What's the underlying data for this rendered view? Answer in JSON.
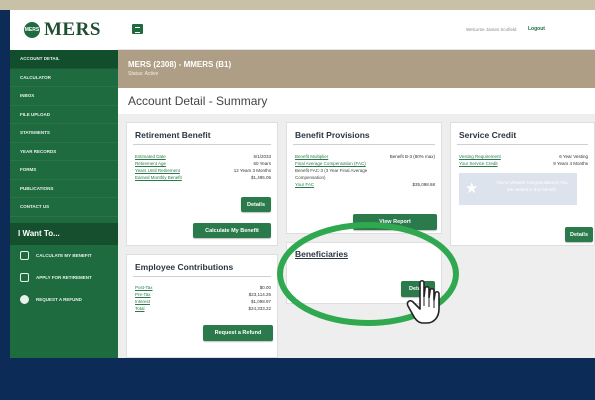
{
  "logo": {
    "mark": "MERS",
    "text": "MERS"
  },
  "sidebar": {
    "items": [
      {
        "label": "ACCOUNT DETAIL"
      },
      {
        "label": "CALCULATOR"
      },
      {
        "label": "INBOX"
      },
      {
        "label": "FILE UPLOAD"
      },
      {
        "label": "STATEMENTS"
      },
      {
        "label": "YEAR RECORDS"
      },
      {
        "label": "FORMS"
      },
      {
        "label": "PUBLICATIONS"
      },
      {
        "label": "CONTACT US"
      }
    ],
    "i_want_to": "I Want To...",
    "actions": [
      {
        "label": "CALCULATE MY BENEFIT",
        "icon": "calculator-icon"
      },
      {
        "label": "APPLY FOR RETIREMENT",
        "icon": "document-icon"
      },
      {
        "label": "REQUEST A REFUND",
        "icon": "hand-icon"
      }
    ]
  },
  "header": {
    "welcome": "Welcome James Scofield",
    "logout": "Logout"
  },
  "banner": {
    "title": "MERS (2308) - MMERS (B1)",
    "status": "Status: Active"
  },
  "page_title": "Account Detail - Summary",
  "retirement_benefit": {
    "title": "Retirement Benefit",
    "rows": [
      {
        "k": "Estimated Date",
        "v": "5/1/2033"
      },
      {
        "k": "Retirement Age",
        "v": "60 Years"
      },
      {
        "k": "Years Until Retirement",
        "v": "12 Years 3 Months"
      },
      {
        "k": "Earned Monthly Benefit",
        "v": "$1,495.05"
      }
    ],
    "details_button": "Details",
    "calc_button": "Calculate My Benefit"
  },
  "benefit_provisions": {
    "title": "Benefit Provisions",
    "rows": [
      {
        "k": "Benefit Multiplier",
        "v": "Benefit B-3 (80% max)"
      },
      {
        "k": "Final Average Compensation (FAC)",
        "v": ""
      },
      {
        "k": "Benefit FAC-3 (3 Year Final Average",
        "v": ""
      },
      {
        "k": "Compensation)",
        "v": ""
      },
      {
        "k": "Your FAC",
        "v": "$35,098.68"
      }
    ],
    "view_button": "View Report"
  },
  "service_credit": {
    "title": "Service Credit",
    "rows": [
      {
        "k": "Vesting Requirement",
        "v": "6 Year Vesting"
      },
      {
        "k": "Your Service Credit",
        "v": "9 Years 4 Months"
      }
    ],
    "vested_message": "You're Vested! Congratulations! You are vested in this benefit.",
    "details_button": "Details"
  },
  "employee_contributions": {
    "title": "Employee Contributions",
    "rows": [
      {
        "k": "Post-Tax",
        "v": "$0.00"
      },
      {
        "k": "Pre-Tax",
        "v": "$23,114.25"
      },
      {
        "k": "Interest",
        "v": "$1,098.97"
      },
      {
        "k": "Total",
        "v": "$24,333.22"
      }
    ],
    "refund_button": "Request a Refund"
  },
  "beneficiaries": {
    "title": "Beneficiaries",
    "details_button": "Details"
  },
  "colors": {
    "brand_green": "#1f6b40",
    "button_green": "#2b7a4b",
    "banner_tan": "#ad9e85",
    "frame_navy": "#0d2b57",
    "highlight_green": "#2fa84f"
  }
}
